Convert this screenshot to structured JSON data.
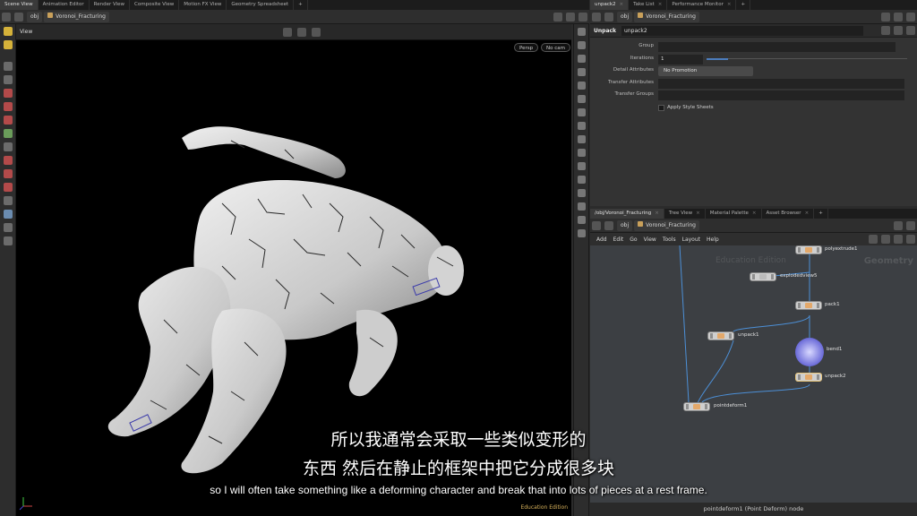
{
  "viewport_tabs": [
    "Scene View",
    "Animation Editor",
    "Render View",
    "Composite View",
    "Motion FX View",
    "Geometry Spreadsheet"
  ],
  "param_tabs": [
    "unpack2",
    "Take List",
    "Performance Monitor"
  ],
  "network_tabs": [
    "/obj/Voronoi_Fracturing",
    "Tree View",
    "Material Palette",
    "Asset Browser"
  ],
  "path": {
    "root": "obj",
    "node": "Voronoi_Fracturing"
  },
  "viewport": {
    "label": "View",
    "camera_mode": "Persp",
    "camera": "No cam",
    "edition": "Education Edition"
  },
  "params": {
    "node_type": "Unpack",
    "node_name": "unpack2",
    "group_label": "Group",
    "group_value": "",
    "iterations_label": "Iterations",
    "iterations_value": "1",
    "detail_attrs_label": "Detail Attributes",
    "detail_attrs_value": "No Promotion",
    "transfer_attrs_label": "Transfer Attributes",
    "transfer_attrs_value": "",
    "transfer_groups_label": "Transfer Groups",
    "transfer_groups_value": "",
    "style_sheets_label": "Apply Style Sheets"
  },
  "network": {
    "menu": [
      "Add",
      "Edit",
      "Go",
      "View",
      "Tools",
      "Layout",
      "Help"
    ],
    "edition_watermark": "Education Edition",
    "context_label": "Geometry",
    "nodes": {
      "polyextrude": "polyextrude1",
      "explodedview": "explodedview5",
      "pack": "pack1",
      "unpack1": "unpack1",
      "bend": "bend1",
      "unpack2": "unpack2",
      "pointdeform": "pointdeform1"
    },
    "status": "pointdeform1 (Point Deform) node"
  },
  "subtitles": {
    "cn_line1": "所以我通常会采取一些类似变形的",
    "cn_line2": "东西 然后在静止的框架中把它分成很多块",
    "en": "so I will often take something like a deforming character and break that into lots of pieces at a rest frame."
  },
  "colors": {
    "background": "#2b2b2b",
    "viewport": "#000000",
    "network_bg": "#3c3f43",
    "wire": "#4c8fd6",
    "edition_gold": "#d9b35c"
  }
}
